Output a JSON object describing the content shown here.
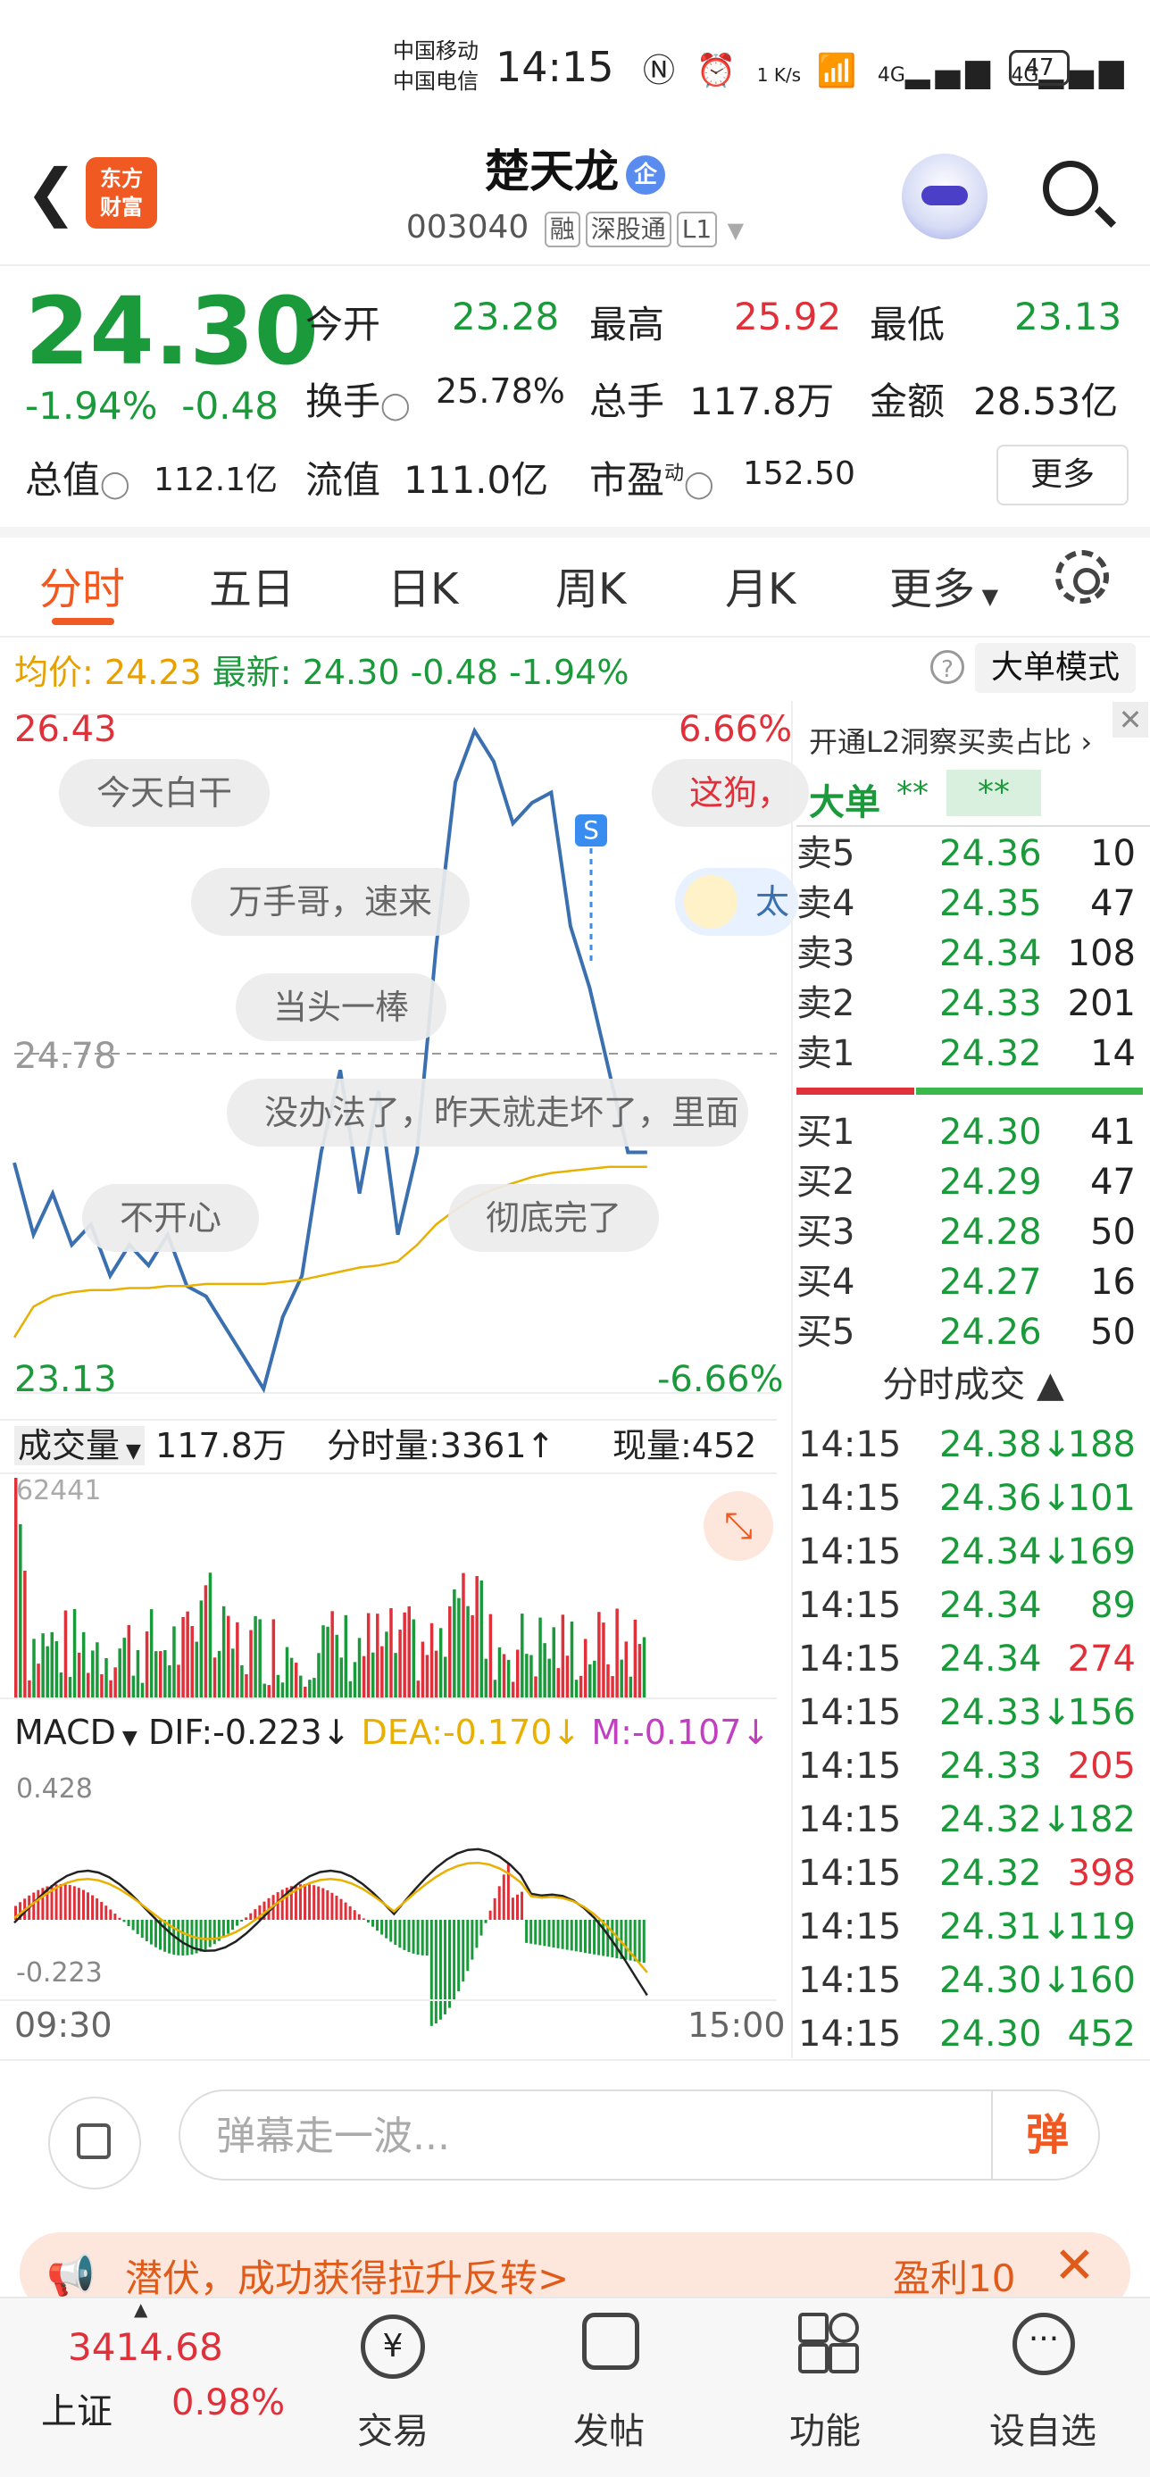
{
  "status_bar": {
    "carrier1": "中国移动",
    "carrier2": "中国电信",
    "time": "14:15",
    "net_speed": "1 K/s",
    "signal1": "4G",
    "signal2": "4G",
    "battery": "47"
  },
  "header": {
    "stock_name": "楚天龙",
    "badge": "企",
    "code": "003040",
    "tags": [
      "融",
      "深股通",
      "L1"
    ],
    "logo_line1": "东方",
    "logo_line2": "财富"
  },
  "quote": {
    "price": "24.30",
    "pct": "-1.94%",
    "chg": "-0.48",
    "open_label": "今开",
    "open": "23.28",
    "high_label": "最高",
    "high": "25.92",
    "low_label": "最低",
    "low": "23.13",
    "turnover_label": "换手",
    "turnover": "25.78%",
    "volume_label": "总手",
    "volume": "117.8万",
    "amount_label": "金额",
    "amount": "28.53亿",
    "mktcap_label": "总值",
    "mktcap": "112.1亿",
    "float_label": "流值",
    "float": "111.0亿",
    "pe_label": "市盈",
    "pe_sup": "动",
    "pe": "152.50",
    "more_btn": "更多"
  },
  "tabs": [
    "分时",
    "五日",
    "日K",
    "周K",
    "月K",
    "更多"
  ],
  "info": {
    "avg_label": "均价:",
    "avg": "24.23",
    "latest_label": "最新:",
    "latest": "24.30",
    "chg": "-0.48",
    "pct": "-1.94%",
    "big_order_btn": "大单模式"
  },
  "chart": {
    "y_top": "26.43",
    "y_mid": "24.78",
    "y_bottom": "23.13",
    "pct_top": "6.66%",
    "pct_bottom": "-6.66%",
    "time_start": "09:30",
    "time_end": "15:00",
    "danmaku": [
      "今天白干",
      "这狗，",
      "万手哥，速来",
      "太",
      "当头一棒",
      "没办法了，昨天就走坏了，里面",
      "不开心",
      "彻底完了"
    ],
    "s_marker": "S",
    "vol_label": "成交量",
    "vol_total": "117.8万",
    "vol_tick_label": "分时量:3361",
    "vol_now": "现量:452",
    "vol_max": "62441",
    "macd_label": "MACD",
    "dif": "DIF:-0.223",
    "dea": "DEA:-0.170",
    "m": "M:-0.107",
    "macd_top": "0.428",
    "macd_bottom": "-0.223"
  },
  "chart_data": {
    "type": "line",
    "title": "",
    "ylim": [
      23.13,
      26.43
    ],
    "series": [
      {
        "values": [
          24.25,
          23.9,
          24.1,
          23.85,
          23.95,
          23.7,
          23.85,
          23.75,
          23.9,
          23.65,
          23.6,
          23.45,
          23.3,
          23.15,
          23.5,
          23.7,
          24.3,
          24.7,
          24.1,
          24.6,
          23.9,
          24.3,
          25.3,
          26.1,
          26.35,
          26.2,
          25.9,
          26.0,
          26.05,
          25.4,
          25.1,
          24.7,
          24.3,
          24.3
        ]
      },
      {
        "values": [
          23.4,
          23.55,
          23.6,
          23.62,
          23.63,
          23.63,
          23.64,
          23.64,
          23.65,
          23.65,
          23.66,
          23.66,
          23.66,
          23.66,
          23.67,
          23.68,
          23.7,
          23.72,
          23.74,
          23.75,
          23.77,
          23.85,
          23.95,
          24.02,
          24.08,
          24.12,
          24.15,
          24.18,
          24.2,
          24.21,
          24.22,
          24.23,
          24.23,
          24.23
        ]
      }
    ]
  },
  "orderbook": {
    "header": "开通L2洞察买卖占比",
    "big_label": "大单",
    "big_buy": "**",
    "big_sell": "**",
    "asks": [
      [
        "卖5",
        "24.36",
        "10"
      ],
      [
        "卖4",
        "24.35",
        "47"
      ],
      [
        "卖3",
        "24.34",
        "108"
      ],
      [
        "卖2",
        "24.33",
        "201"
      ],
      [
        "卖1",
        "24.32",
        "14"
      ]
    ],
    "bids": [
      [
        "买1",
        "24.30",
        "41"
      ],
      [
        "买2",
        "24.29",
        "47"
      ],
      [
        "买3",
        "24.28",
        "50"
      ],
      [
        "买4",
        "24.27",
        "16"
      ],
      [
        "买5",
        "24.26",
        "50"
      ]
    ],
    "ticks_label": "分时成交",
    "ticks": [
      [
        "14:15",
        "24.38↓",
        "188",
        "g"
      ],
      [
        "14:15",
        "24.36↓",
        "101",
        "g"
      ],
      [
        "14:15",
        "24.34↓",
        "169",
        "g"
      ],
      [
        "14:15",
        "24.34",
        "89",
        "g"
      ],
      [
        "14:15",
        "24.34",
        "274",
        "r"
      ],
      [
        "14:15",
        "24.33↓",
        "156",
        "g"
      ],
      [
        "14:15",
        "24.33",
        "205",
        "r"
      ],
      [
        "14:15",
        "24.32↓",
        "182",
        "g"
      ],
      [
        "14:15",
        "24.32",
        "398",
        "r"
      ],
      [
        "14:15",
        "24.31↓",
        "119",
        "g"
      ],
      [
        "14:15",
        "24.30↓",
        "160",
        "g"
      ],
      [
        "14:15",
        "24.30",
        "452",
        "g"
      ]
    ]
  },
  "danmaku_bar": {
    "placeholder": "弹幕走一波...",
    "send": "弹"
  },
  "promo": {
    "text": "潜伏，成功获得拉升反转>",
    "profit": "盈利10"
  },
  "bottom_nav": {
    "index_value": "3414.68",
    "index_name": "上证",
    "index_pct": "0.98%",
    "items": [
      "交易",
      "发帖",
      "功能",
      "设自选"
    ]
  },
  "colors": {
    "up": "#e0303a",
    "down": "#1a9a3a",
    "accent": "#f05a22",
    "price_line": "#3a6fb0",
    "avg_line": "#e8b000"
  }
}
